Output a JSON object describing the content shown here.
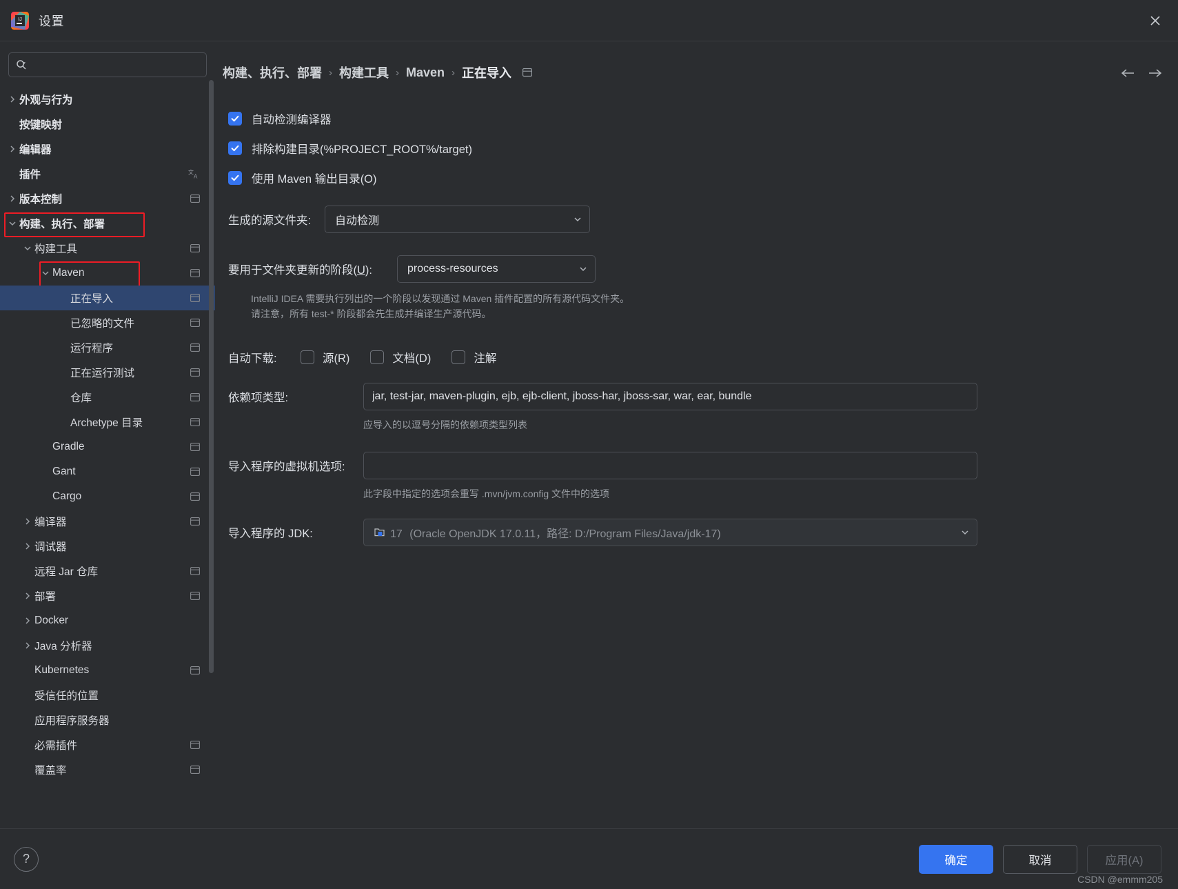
{
  "window": {
    "title": "设置",
    "logo_icon": "intellij-idea-logo",
    "close_icon": "close-icon"
  },
  "search": {
    "placeholder": "",
    "value": "",
    "icon": "search-icon"
  },
  "sidebar": {
    "scrollbar": true,
    "items": [
      {
        "label": "外观与行为",
        "level": 0,
        "arrow": "right",
        "badge": false,
        "selected": false,
        "highlight": ""
      },
      {
        "label": "按键映射",
        "level": 0,
        "arrow": "none",
        "badge": false,
        "selected": false,
        "highlight": ""
      },
      {
        "label": "编辑器",
        "level": 0,
        "arrow": "right",
        "badge": false,
        "selected": false,
        "highlight": ""
      },
      {
        "label": "插件",
        "level": 0,
        "arrow": "none",
        "badge": "translate",
        "selected": false,
        "highlight": ""
      },
      {
        "label": "版本控制",
        "level": 0,
        "arrow": "right",
        "badge": true,
        "selected": false,
        "highlight": ""
      },
      {
        "label": "构建、执行、部署",
        "level": 0,
        "arrow": "down",
        "badge": false,
        "selected": false,
        "highlight": "bed"
      },
      {
        "label": "构建工具",
        "level": 1,
        "arrow": "down",
        "badge": true,
        "selected": false,
        "highlight": ""
      },
      {
        "label": "Maven",
        "level": 2,
        "arrow": "down",
        "badge": true,
        "selected": false,
        "highlight": "maven"
      },
      {
        "label": "正在导入",
        "level": 3,
        "arrow": "none",
        "badge": true,
        "selected": true,
        "highlight": ""
      },
      {
        "label": "已忽略的文件",
        "level": 3,
        "arrow": "none",
        "badge": true,
        "selected": false,
        "highlight": ""
      },
      {
        "label": "运行程序",
        "level": 3,
        "arrow": "none",
        "badge": true,
        "selected": false,
        "highlight": ""
      },
      {
        "label": "正在运行测试",
        "level": 3,
        "arrow": "none",
        "badge": true,
        "selected": false,
        "highlight": ""
      },
      {
        "label": "仓库",
        "level": 3,
        "arrow": "none",
        "badge": true,
        "selected": false,
        "highlight": ""
      },
      {
        "label": "Archetype 目录",
        "level": 3,
        "arrow": "none",
        "badge": true,
        "selected": false,
        "highlight": ""
      },
      {
        "label": "Gradle",
        "level": 2,
        "arrow": "none",
        "badge": true,
        "selected": false,
        "highlight": ""
      },
      {
        "label": "Gant",
        "level": 2,
        "arrow": "none",
        "badge": true,
        "selected": false,
        "highlight": ""
      },
      {
        "label": "Cargo",
        "level": 2,
        "arrow": "none",
        "badge": true,
        "selected": false,
        "highlight": ""
      },
      {
        "label": "编译器",
        "level": 1,
        "arrow": "right",
        "badge": true,
        "selected": false,
        "highlight": ""
      },
      {
        "label": "调试器",
        "level": 1,
        "arrow": "right",
        "badge": false,
        "selected": false,
        "highlight": ""
      },
      {
        "label": "远程 Jar 仓库",
        "level": 1,
        "arrow": "none",
        "badge": true,
        "selected": false,
        "highlight": ""
      },
      {
        "label": "部署",
        "level": 1,
        "arrow": "right",
        "badge": true,
        "selected": false,
        "highlight": ""
      },
      {
        "label": "Docker",
        "level": 1,
        "arrow": "right",
        "badge": false,
        "selected": false,
        "highlight": ""
      },
      {
        "label": "Java 分析器",
        "level": 1,
        "arrow": "right",
        "badge": false,
        "selected": false,
        "highlight": ""
      },
      {
        "label": "Kubernetes",
        "level": 1,
        "arrow": "none",
        "badge": true,
        "selected": false,
        "highlight": ""
      },
      {
        "label": "受信任的位置",
        "level": 1,
        "arrow": "none",
        "badge": false,
        "selected": false,
        "highlight": ""
      },
      {
        "label": "应用程序服务器",
        "level": 1,
        "arrow": "none",
        "badge": false,
        "selected": false,
        "highlight": ""
      },
      {
        "label": "必需插件",
        "level": 1,
        "arrow": "none",
        "badge": true,
        "selected": false,
        "highlight": ""
      },
      {
        "label": "覆盖率",
        "level": 1,
        "arrow": "none",
        "badge": true,
        "selected": false,
        "highlight": ""
      }
    ]
  },
  "breadcrumb": {
    "items": [
      "构建、执行、部署",
      "构建工具",
      "Maven",
      "正在导入"
    ],
    "separator": "›",
    "trailing_icon": "project-scope-icon",
    "back_icon": "arrow-left-icon",
    "forward_icon": "arrow-right-icon"
  },
  "main": {
    "checkboxes": [
      {
        "label": "自动检测编译器",
        "checked": true
      },
      {
        "label": "排除构建目录(%PROJECT_ROOT%/target)",
        "checked": true
      },
      {
        "label": "使用 Maven 输出目录(O)",
        "checked": true
      }
    ],
    "generated_sources": {
      "label": "生成的源文件夹:",
      "value": "自动检测",
      "chevron_icon": "chevron-down-icon"
    },
    "phase": {
      "label_pre": "要用于文件夹更新的阶段(",
      "label_mnemonic": "U",
      "label_post": "):",
      "value": "process-resources",
      "chevron_icon": "chevron-down-icon",
      "hint_line1": "IntelliJ IDEA 需要执行列出的一个阶段以发现通过 Maven 插件配置的所有源代码文件夹。",
      "hint_line2": "请注意，所有 test-* 阶段都会先生成并编译生产源代码。"
    },
    "auto_download": {
      "label": "自动下载:",
      "options": [
        {
          "label": "源(R)",
          "checked": false
        },
        {
          "label": "文档(D)",
          "checked": false
        },
        {
          "label": "注解",
          "checked": false
        }
      ]
    },
    "dependency_types": {
      "label": "依赖项类型:",
      "value": "jar, test-jar, maven-plugin, ejb, ejb-client, jboss-har, jboss-sar, war, ear, bundle",
      "placeholder": "",
      "hint": "应导入的以逗号分隔的依赖项类型列表"
    },
    "vm_options": {
      "label": "导入程序的虚拟机选项:",
      "value": "",
      "placeholder": "",
      "hint": "此字段中指定的选项会重写 .mvn/jvm.config 文件中的选项"
    },
    "jdk": {
      "label": "导入程序的 JDK:",
      "version": "17",
      "detail": "(Oracle OpenJDK 17.0.11，路径: D:/Program Files/Java/jdk-17)",
      "icon": "jdk-module-icon",
      "chevron_icon": "chevron-down-icon",
      "disabled": true
    }
  },
  "footer": {
    "help_label": "?",
    "ok": "确定",
    "cancel": "取消",
    "apply": "应用(A)",
    "watermark": "CSDN @emmm205"
  },
  "colors": {
    "accent": "#3574f0",
    "selection": "#2f4670",
    "highlight_box": "#ee1c25",
    "panel_bg": "#2b2d30",
    "border": "#4e5157"
  }
}
